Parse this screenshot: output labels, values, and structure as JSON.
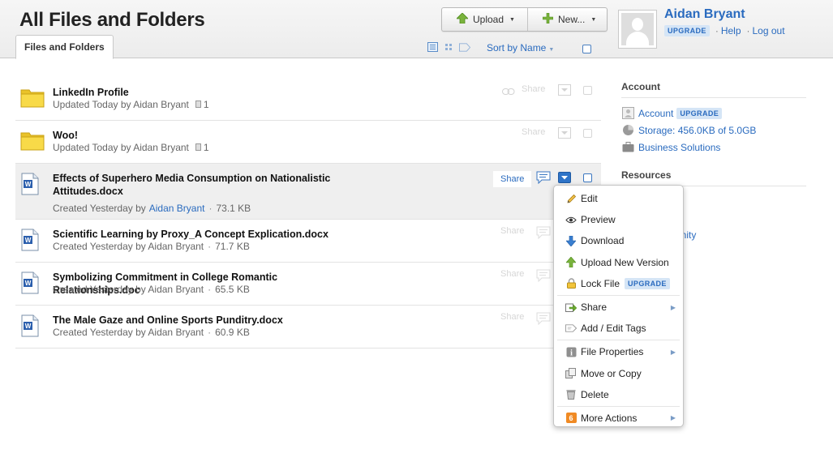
{
  "header": {
    "title": "All Files and Folders",
    "tab_label": "Files and Folders",
    "upload_label": "Upload",
    "new_label": "New...",
    "sort_label": "Sort by Name"
  },
  "user": {
    "name": "Aidan Bryant",
    "upgrade_badge": "UPGRADE",
    "help_label": "Help",
    "logout_label": "Log out"
  },
  "files": [
    {
      "name": "LinkedIn Profile",
      "meta": "Updated Today by Aidan Bryant",
      "count": "1",
      "share": "Share",
      "type": "folder"
    },
    {
      "name": "Woo!",
      "meta": "Updated Today by Aidan Bryant",
      "count": "1",
      "share": "Share",
      "type": "folder"
    },
    {
      "name": "Effects of Superhero Media Consumption on Nationalistic Attitudes.docx",
      "meta_prefix": "Created Yesterday by",
      "meta_user": "Aidan Bryant",
      "size": "73.1 KB",
      "share": "Share",
      "type": "doc"
    },
    {
      "name": "Scientific Learning by Proxy_A Concept Explication.docx",
      "meta": "Created Yesterday by Aidan Bryant",
      "size": "71.7 KB",
      "share": "Share",
      "type": "doc"
    },
    {
      "name": "Symbolizing Commitment in College Romantic Relationships.doc",
      "meta": "Created Yesterday by Aidan Bryant",
      "size": "65.5 KB",
      "share": "Share",
      "type": "doc"
    },
    {
      "name": "The Male Gaze and Online Sports Punditry.docx",
      "meta": "Created Yesterday by Aidan Bryant",
      "size": "60.9 KB",
      "share": "Share",
      "type": "doc"
    }
  ],
  "sidebar": {
    "account_title": "Account",
    "account_link": "Account",
    "upgrade_badge": "UPGRADE",
    "storage": "Storage: 456.0KB of 5.0GB",
    "business": "Business Solutions",
    "resources_title": "Resources",
    "partial_link": "munity"
  },
  "context_menu": {
    "items": [
      {
        "label": "Edit",
        "icon": "pencil-icon"
      },
      {
        "label": "Preview",
        "icon": "eye-icon"
      },
      {
        "label": "Download",
        "icon": "download-arrow-icon"
      },
      {
        "label": "Upload New Version",
        "icon": "upload-arrow-icon"
      },
      {
        "label": "Lock File",
        "icon": "lock-icon",
        "badge": "UPGRADE"
      },
      {
        "label": "Share",
        "icon": "share-icon",
        "submenu": true
      },
      {
        "label": "Add / Edit Tags",
        "icon": "tag-icon"
      },
      {
        "label": "File Properties",
        "icon": "info-icon",
        "submenu": true
      },
      {
        "label": "Move or Copy",
        "icon": "move-icon"
      },
      {
        "label": "Delete",
        "icon": "trash-icon"
      },
      {
        "label": "More Actions",
        "icon": "more-actions-icon",
        "badge_count": "6",
        "submenu": true
      }
    ]
  },
  "colors": {
    "link": "#2a6bbf",
    "upgrade_bg": "#d5e5f6",
    "folder": "#f2d33c",
    "more_badge": "#f08a24"
  }
}
